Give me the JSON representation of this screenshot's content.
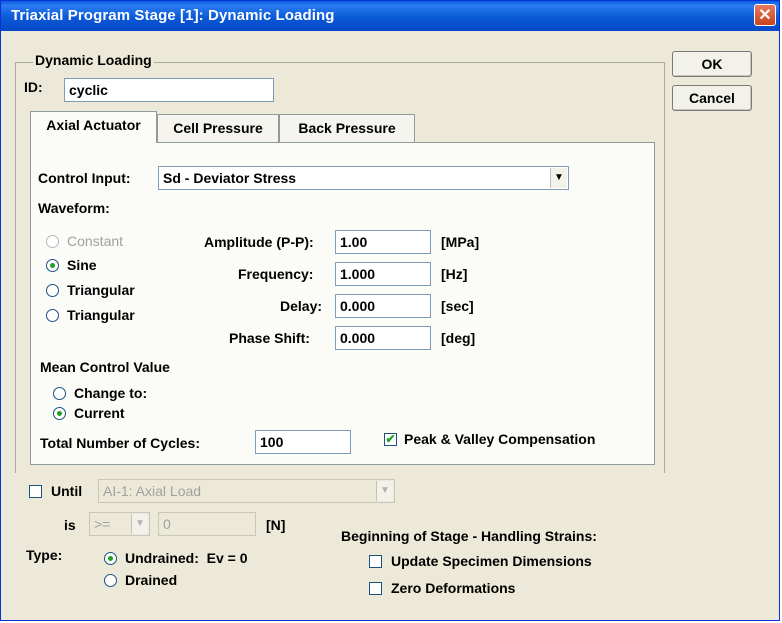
{
  "window": {
    "title": "Triaxial Program Stage [1]: Dynamic Loading",
    "close_glyph": "✕"
  },
  "buttons": {
    "ok": "OK",
    "cancel": "Cancel"
  },
  "group": {
    "title": "Dynamic Loading",
    "id_label": "ID:",
    "id_value": "cyclic"
  },
  "tabs": [
    "Axial Actuator",
    "Cell Pressure",
    "Back Pressure"
  ],
  "control_input": {
    "label": "Control Input:",
    "value": "Sd - Deviator Stress"
  },
  "waveform": {
    "label": "Waveform:",
    "options": [
      "Constant",
      "Sine",
      "Triangular",
      "Triangular"
    ],
    "selected": "Sine"
  },
  "params": [
    {
      "label": "Amplitude (P-P):",
      "value": "1.00",
      "unit": "[MPa]"
    },
    {
      "label": "Frequency:",
      "value": "1.000",
      "unit": "[Hz]"
    },
    {
      "label": "Delay:",
      "value": "0.000",
      "unit": "[sec]"
    },
    {
      "label": "Phase Shift:",
      "value": "0.000",
      "unit": "[deg]"
    }
  ],
  "mean_control": {
    "label": "Mean Control Value",
    "options": [
      "Change to:",
      "Current"
    ],
    "selected": "Current"
  },
  "cycles": {
    "label": "Total Number of Cycles:",
    "value": "100"
  },
  "peak_valley": {
    "label": "Peak & Valley Compensation",
    "checked": true,
    "check_glyph": "✔"
  },
  "until": {
    "label": "Until",
    "channel": "AI-1: Axial Load",
    "is_label": "is",
    "operator": ">=",
    "value": "0",
    "unit": "[N]",
    "checked": false
  },
  "type": {
    "label": "Type:",
    "options": [
      "Undrained:  Ev = 0",
      "Drained"
    ],
    "selected": "Undrained:  Ev = 0"
  },
  "strains": {
    "title": "Beginning of Stage - Handling Strains:",
    "options": [
      "Update Specimen Dimensions",
      "Zero Deformations"
    ],
    "checked": [
      false,
      false
    ]
  },
  "dropdown_glyph": "▼"
}
